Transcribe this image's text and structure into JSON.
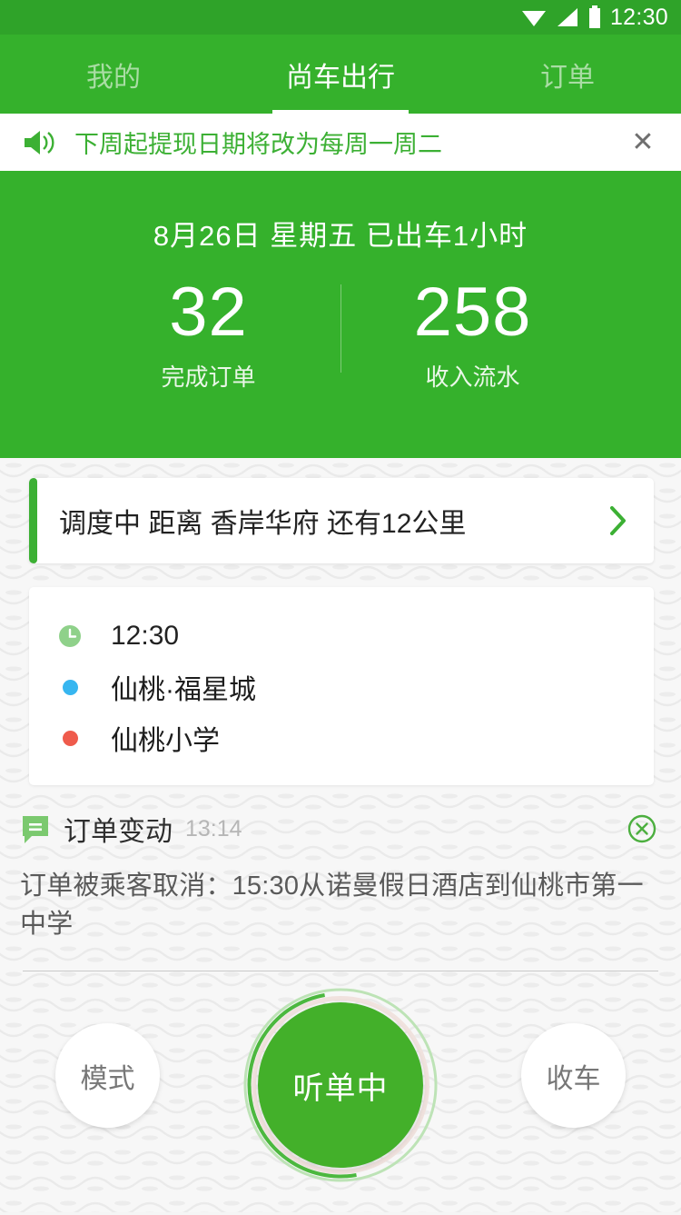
{
  "statusbar": {
    "time": "12:30",
    "icons": [
      "wifi-icon",
      "signal-icon",
      "battery-icon"
    ]
  },
  "tabs": [
    {
      "label": "我的",
      "active": false,
      "name": "tab-mine"
    },
    {
      "label": "尚车出行",
      "active": true,
      "name": "tab-home"
    },
    {
      "label": "订单",
      "active": false,
      "name": "tab-orders"
    }
  ],
  "announcement": {
    "icon": "speaker-icon",
    "text": "下周起提现日期将改为每周一周二",
    "close_label": "✕",
    "accent": "#3cb034"
  },
  "hero": {
    "date_line": "8月26日  星期五  已出车1小时",
    "stats": [
      {
        "value": "32",
        "label": "完成订单"
      },
      {
        "value": "258",
        "label": "收入流水"
      }
    ],
    "bg": "#35b12c"
  },
  "dispatch": {
    "text": "调度中  距离 香岸华府 还有12公里",
    "chevron": "chevron-right-icon",
    "accent": "#3cb034"
  },
  "trip": {
    "rows": [
      {
        "bullet": "clock-icon",
        "color": "#8fd18a",
        "text": "12:30"
      },
      {
        "bullet": "origin-dot",
        "color": "#37b6f0",
        "text": "仙桃·福星城"
      },
      {
        "bullet": "dest-dot",
        "color": "#ef5b4c",
        "text": "仙桃小学"
      }
    ]
  },
  "notice": {
    "icon": "message-bubble-icon",
    "title": "订单变动",
    "time": "13:14",
    "body": "订单被乘客取消：15:30从诺曼假日酒店到仙桃市第一中学",
    "close": "close-circle-icon"
  },
  "actions": {
    "left": {
      "label": "模式",
      "name": "mode-button"
    },
    "main": {
      "label": "听单中",
      "name": "listening-button",
      "color": "#43b02a"
    },
    "right": {
      "label": "收车",
      "name": "end-shift-button"
    }
  }
}
